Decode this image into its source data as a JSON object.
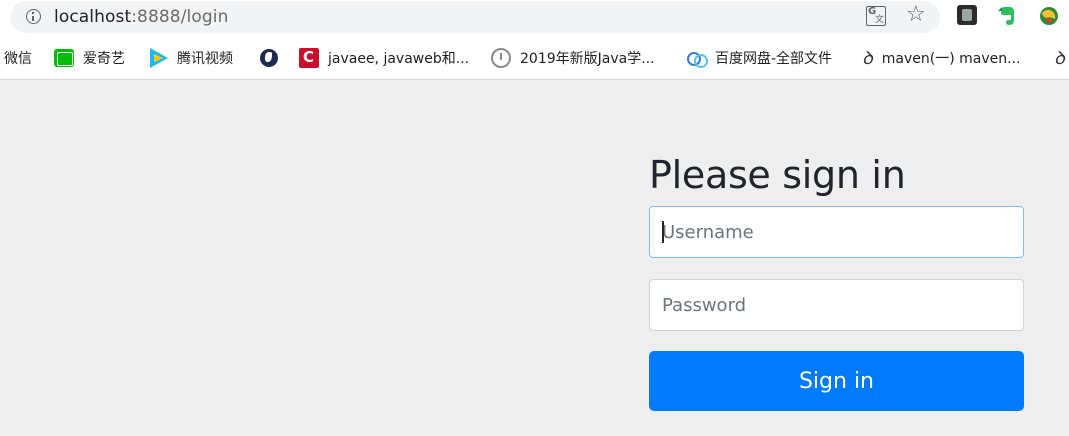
{
  "browser": {
    "url_host": "localhost",
    "url_rest": ":8888/login",
    "extension_icons": [
      "translate-icon",
      "star-icon",
      "extension-icon",
      "evernote-icon",
      "extension-globe-icon"
    ]
  },
  "bookmarks": [
    {
      "label": "微信",
      "icon": "none"
    },
    {
      "label": "爱奇艺",
      "icon": "iqiyi-icon"
    },
    {
      "label": "腾讯视频",
      "icon": "tencent-video-icon"
    },
    {
      "label": "",
      "icon": "globe-icon"
    },
    {
      "label": "javaee, javaweb和...",
      "icon": "csdn-icon"
    },
    {
      "label": "2019年新版Java学...",
      "icon": "clock-icon"
    },
    {
      "label": "百度网盘-全部文件",
      "icon": "baidu-pan-icon"
    },
    {
      "label": "maven(一) maven...",
      "icon": "maven-icon"
    },
    {
      "label": "",
      "icon": "maven-icon"
    }
  ],
  "login": {
    "title": "Please sign in",
    "username_placeholder": "Username",
    "password_placeholder": "Password",
    "submit_label": "Sign in"
  },
  "colors": {
    "primary": "#007bff",
    "background": "#eeeeee",
    "text": "#212529"
  }
}
